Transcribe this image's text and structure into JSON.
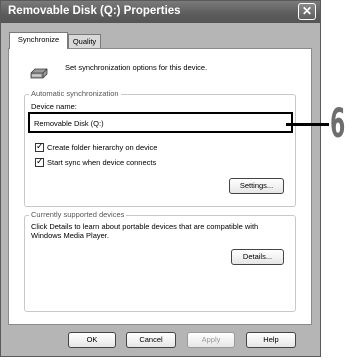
{
  "window": {
    "title": "Removable Disk (Q:) Properties",
    "close_glyph": "✕"
  },
  "tabs": [
    {
      "label": "Synchronize",
      "active": true
    },
    {
      "label": "Quality",
      "active": false
    }
  ],
  "intro": {
    "icon": "removable-drive-icon",
    "text": "Set synchronization options for this device."
  },
  "auto_sync": {
    "group_label": "Automatic synchronization",
    "device_name_label": "Device name:",
    "device_name_value": "Removable Disk (Q:)",
    "create_folder_hierarchy": {
      "label": "Create folder hierarchy on device",
      "checked": true
    },
    "start_sync": {
      "label": "Start sync when device connects",
      "checked": true
    },
    "settings_button": "Settings..."
  },
  "supported": {
    "group_label": "Currently supported devices",
    "description_line1": "Click Details to learn about portable devices that are compatible with",
    "description_line2": "Windows Media Player.",
    "details_button": "Details..."
  },
  "footer": {
    "ok": "OK",
    "cancel": "Cancel",
    "apply": "Apply",
    "help": "Help"
  },
  "callout": {
    "number": "6"
  },
  "colors": {
    "titlebar": "#5c5c5c",
    "window_frame": "#b5b5b5",
    "highlight_border": "#000000",
    "callout_number": "#6e6e6e"
  }
}
